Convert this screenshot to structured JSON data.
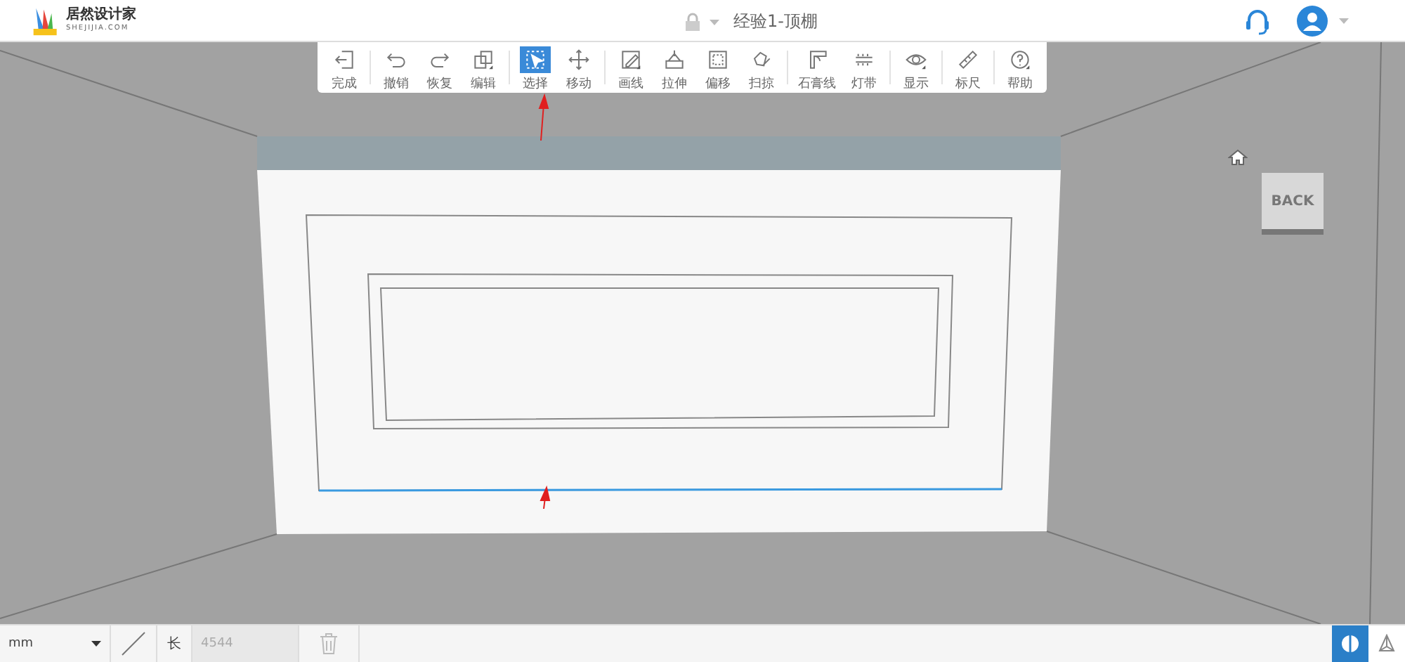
{
  "header": {
    "brand": "居然设计家",
    "brand_sub": "SHEJIJIA.COM",
    "title": "经验1-顶棚"
  },
  "toolbar": {
    "groups": [
      [
        {
          "label": "完成",
          "selected": false,
          "dropdown": false
        }
      ],
      [
        {
          "label": "撤销",
          "selected": false,
          "dropdown": false
        },
        {
          "label": "恢复",
          "selected": false,
          "dropdown": false
        },
        {
          "label": "编辑",
          "selected": false,
          "dropdown": true
        }
      ],
      [
        {
          "label": "选择",
          "selected": true,
          "dropdown": false
        },
        {
          "label": "移动",
          "selected": false,
          "dropdown": false
        }
      ],
      [
        {
          "label": "画线",
          "selected": false,
          "dropdown": true
        },
        {
          "label": "拉伸",
          "selected": false,
          "dropdown": false
        },
        {
          "label": "偏移",
          "selected": false,
          "dropdown": false
        },
        {
          "label": "扫掠",
          "selected": false,
          "dropdown": false
        }
      ],
      [
        {
          "label": "石膏线",
          "selected": false,
          "dropdown": false
        },
        {
          "label": "灯带",
          "selected": false,
          "dropdown": false
        }
      ],
      [
        {
          "label": "显示",
          "selected": false,
          "dropdown": true
        }
      ],
      [
        {
          "label": "标尺",
          "selected": false,
          "dropdown": false
        }
      ],
      [
        {
          "label": "帮助",
          "selected": false,
          "dropdown": true
        }
      ]
    ]
  },
  "back_button": "BACK",
  "bottom_bar": {
    "unit": "mm",
    "length_label": "长",
    "length_value": "4544",
    "views": [
      {
        "selected": true
      },
      {
        "selected": false
      }
    ]
  }
}
